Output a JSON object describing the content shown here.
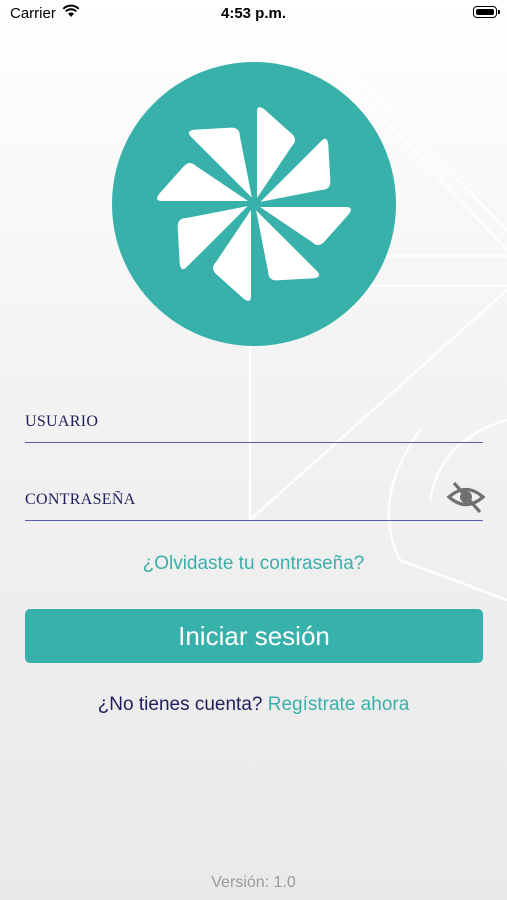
{
  "status_bar": {
    "carrier": "Carrier",
    "time": "4:53 p.m."
  },
  "logo": {
    "icon": "pinwheel-logo-icon",
    "circle_color": "#38b1aa"
  },
  "form": {
    "username_placeholder": "USUARIO",
    "password_placeholder": "CONTRASEÑA",
    "toggle_icon": "eye-slash-icon"
  },
  "forgot_password": "¿Olvidaste tu contraseña?",
  "login_button": "Iniciar sesión",
  "signup": {
    "question": "¿No tienes cuenta?",
    "link": "Regístrate ahora"
  },
  "version": "Versión: 1.0",
  "colors": {
    "accent": "#38b1aa",
    "text_dark": "#1e1e5a",
    "underline": "#5a5ea8"
  }
}
